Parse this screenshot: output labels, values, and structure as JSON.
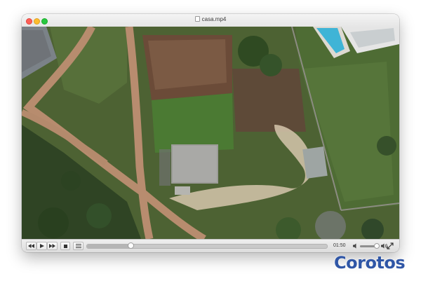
{
  "window": {
    "title": "casa.mp4"
  },
  "player": {
    "time": "01:50",
    "progress": 0.18,
    "volume": 0.85,
    "controls": [
      "rewind-icon",
      "play-icon",
      "fast-forward-icon",
      "stop-icon",
      "playlist-icon",
      "volume-low-icon",
      "volume-high-icon",
      "fullscreen-icon"
    ]
  },
  "colors": {
    "close": "#ff5f57",
    "minimize": "#febc2e",
    "maximize": "#28c840",
    "brand": "#2f56a6"
  },
  "watermark": {
    "text": "Corotos"
  }
}
